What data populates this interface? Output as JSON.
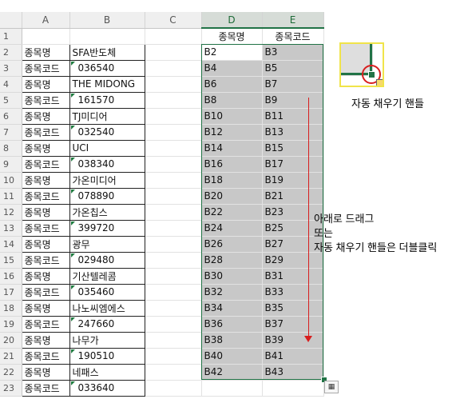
{
  "columns": [
    "A",
    "B",
    "C",
    "D",
    "E"
  ],
  "rows": [
    {
      "n": "1",
      "a": "",
      "b": "",
      "bnum": false,
      "d": "종목명",
      "e": "종목코드",
      "hdr": true
    },
    {
      "n": "2",
      "a": "종목명",
      "b": "SFA반도체",
      "bnum": false,
      "d": "B2",
      "e": "B3"
    },
    {
      "n": "3",
      "a": "종목코드",
      "b": "036540",
      "bnum": true,
      "d": "B4",
      "e": "B5"
    },
    {
      "n": "4",
      "a": "종목명",
      "b": "THE MIDONG",
      "bnum": false,
      "d": "B6",
      "e": "B7"
    },
    {
      "n": "5",
      "a": "종목코드",
      "b": "161570",
      "bnum": true,
      "d": "B8",
      "e": "B9"
    },
    {
      "n": "6",
      "a": "종목명",
      "b": "TJ미디어",
      "bnum": false,
      "d": "B10",
      "e": "B11"
    },
    {
      "n": "7",
      "a": "종목코드",
      "b": "032540",
      "bnum": true,
      "d": "B12",
      "e": "B13"
    },
    {
      "n": "8",
      "a": "종목명",
      "b": "UCI",
      "bnum": false,
      "d": "B14",
      "e": "B15"
    },
    {
      "n": "9",
      "a": "종목코드",
      "b": "038340",
      "bnum": true,
      "d": "B16",
      "e": "B17"
    },
    {
      "n": "10",
      "a": "종목명",
      "b": "가온미디어",
      "bnum": false,
      "d": "B18",
      "e": "B19"
    },
    {
      "n": "11",
      "a": "종목코드",
      "b": "078890",
      "bnum": true,
      "d": "B20",
      "e": "B21"
    },
    {
      "n": "12",
      "a": "종목명",
      "b": "가온칩스",
      "bnum": false,
      "d": "B22",
      "e": "B23"
    },
    {
      "n": "13",
      "a": "종목코드",
      "b": "399720",
      "bnum": true,
      "d": "B24",
      "e": "B25"
    },
    {
      "n": "14",
      "a": "종목명",
      "b": "광무",
      "bnum": false,
      "d": "B26",
      "e": "B27"
    },
    {
      "n": "15",
      "a": "종목코드",
      "b": "029480",
      "bnum": true,
      "d": "B28",
      "e": "B29"
    },
    {
      "n": "16",
      "a": "종목명",
      "b": "기산텔레콤",
      "bnum": false,
      "d": "B30",
      "e": "B31"
    },
    {
      "n": "17",
      "a": "종목코드",
      "b": "035460",
      "bnum": true,
      "d": "B32",
      "e": "B33"
    },
    {
      "n": "18",
      "a": "종목명",
      "b": "나노씨엠에스",
      "bnum": false,
      "d": "B34",
      "e": "B35"
    },
    {
      "n": "19",
      "a": "종목코드",
      "b": "247660",
      "bnum": true,
      "d": "B36",
      "e": "B37"
    },
    {
      "n": "20",
      "a": "종목명",
      "b": "나무가",
      "bnum": false,
      "d": "B38",
      "e": "B39"
    },
    {
      "n": "21",
      "a": "종목코드",
      "b": "190510",
      "bnum": true,
      "d": "B40",
      "e": "B41"
    },
    {
      "n": "22",
      "a": "종목명",
      "b": "네패스",
      "bnum": false,
      "d": "B42",
      "e": "B43"
    },
    {
      "n": "23",
      "a": "종목코드",
      "b": "033640",
      "bnum": true,
      "d": "",
      "e": ""
    }
  ],
  "annotations": {
    "fill_handle_label": "자동 채우기 핸들",
    "drag_line1": "아래로 드래그",
    "drag_line2": "또는",
    "drag_line3": "자동 채우기 핸들은 더블클릭"
  },
  "colors": {
    "selection": "#217346",
    "arrow": "#d81e1e",
    "filled": "#c8c8c8"
  }
}
